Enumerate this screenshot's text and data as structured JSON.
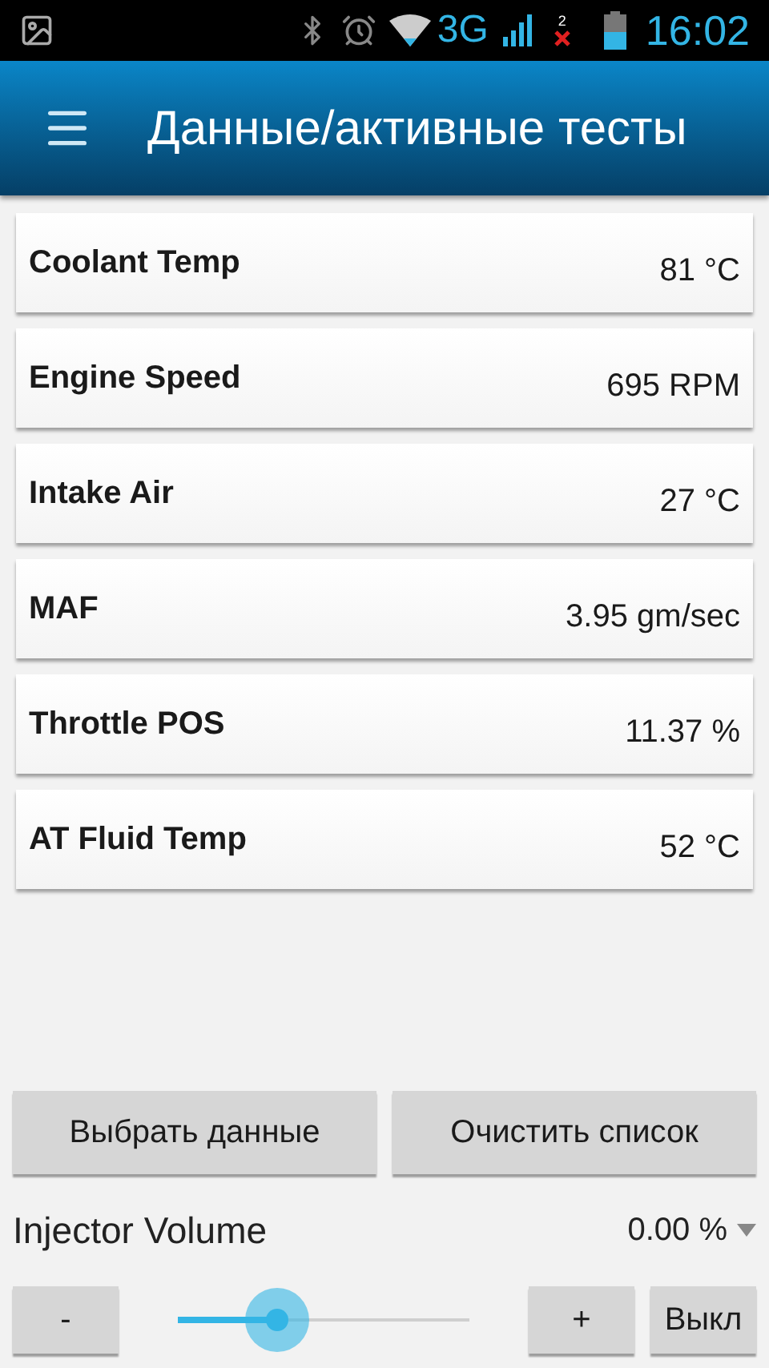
{
  "status_bar": {
    "network": "3G",
    "sim_slot": "2",
    "time": "16:02"
  },
  "app_bar": {
    "title": "Данные/активные тесты"
  },
  "readings": [
    {
      "name": "Coolant Temp",
      "value": "81 °C"
    },
    {
      "name": "Engine Speed",
      "value": "695 RPM"
    },
    {
      "name": "Intake Air",
      "value": "27 °C"
    },
    {
      "name": "MAF",
      "value": "3.95 gm/sec"
    },
    {
      "name": "Throttle POS",
      "value": "11.37 %"
    },
    {
      "name": "AT Fluid Temp",
      "value": "52 °C"
    }
  ],
  "actions": [
    "Выбрать данные",
    "Очистить список"
  ],
  "test": {
    "name": "Injector Volume",
    "value": "0.00 %",
    "decrease": "-",
    "level": 0.34,
    "increase": "+",
    "off": "Выкл"
  }
}
